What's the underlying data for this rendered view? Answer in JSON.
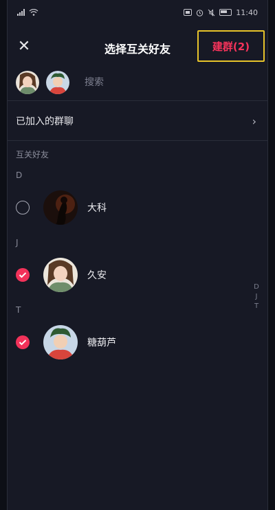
{
  "status_bar": {
    "time": "11:40",
    "signal_icons": [
      "signal-icon",
      "wifi-icon"
    ],
    "right_icons": [
      "nfc-icon",
      "alarm-icon",
      "mute-icon",
      "battery-icon"
    ]
  },
  "header": {
    "close_icon": "close-icon",
    "title": "选择互关好友",
    "create_label": "建群(2)"
  },
  "search": {
    "placeholder": "搜索",
    "selected_avatars": [
      "avatar-jiuan",
      "avatar-tanghulu"
    ]
  },
  "joined_groups": {
    "label": "已加入的群聊"
  },
  "section_title": "互关好友",
  "groups": [
    {
      "letter": "D",
      "contacts": [
        {
          "name": "大科",
          "checked": false
        }
      ]
    },
    {
      "letter": "J",
      "contacts": [
        {
          "name": "久安",
          "checked": true
        }
      ]
    },
    {
      "letter": "T",
      "contacts": [
        {
          "name": "糖葫芦",
          "checked": true
        }
      ]
    }
  ],
  "index_letters": [
    "D",
    "J",
    "T"
  ],
  "colors": {
    "accent": "#f2325a",
    "highlight_box": "#e8c42a",
    "background": "#171925"
  }
}
